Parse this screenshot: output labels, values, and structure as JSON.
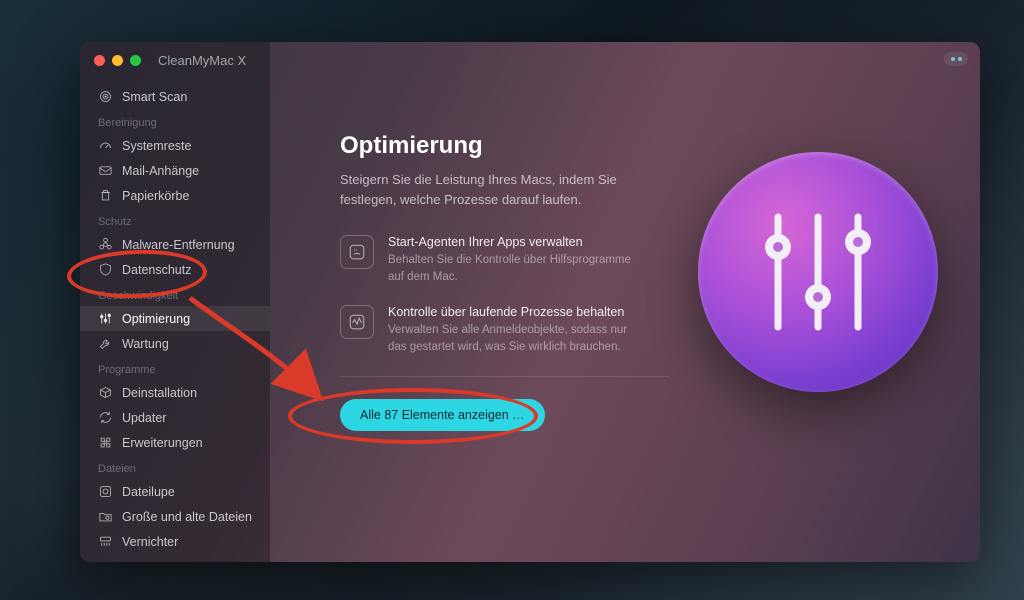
{
  "app_title": "CleanMyMac X",
  "sidebar": {
    "smart_scan": "Smart Scan",
    "sections": {
      "bereinigung": "Bereinigung",
      "schutz": "Schutz",
      "geschwindigkeit": "Geschwindigkeit",
      "programme": "Programme",
      "dateien": "Dateien"
    },
    "items": {
      "systemreste": "Systemreste",
      "mail": "Mail-Anhänge",
      "papierkoerbe": "Papierkörbe",
      "malware": "Malware-Entfernung",
      "datenschutz": "Datenschutz",
      "optimierung": "Optimierung",
      "wartung": "Wartung",
      "deinstallation": "Deinstallation",
      "updater": "Updater",
      "erweiterungen": "Erweiterungen",
      "dateilupe": "Dateilupe",
      "grosse": "Große und alte Dateien",
      "vernichter": "Vernichter"
    }
  },
  "main": {
    "title": "Optimierung",
    "lead": "Steigern Sie die Leistung Ihres Macs, indem Sie festlegen, welche Prozesse darauf laufen.",
    "features": [
      {
        "title": "Start-Agenten Ihrer Apps verwalten",
        "desc": "Behalten Sie die Kontrolle über Hilfsprogramme auf dem Mac."
      },
      {
        "title": "Kontrolle über laufende Prozesse behalten",
        "desc": "Verwalten Sie alle Anmeldeobjekte, sodass nur das gestartet wird, was Sie wirklich brauchen."
      }
    ],
    "cta": "Alle 87 Elemente anzeigen …"
  }
}
